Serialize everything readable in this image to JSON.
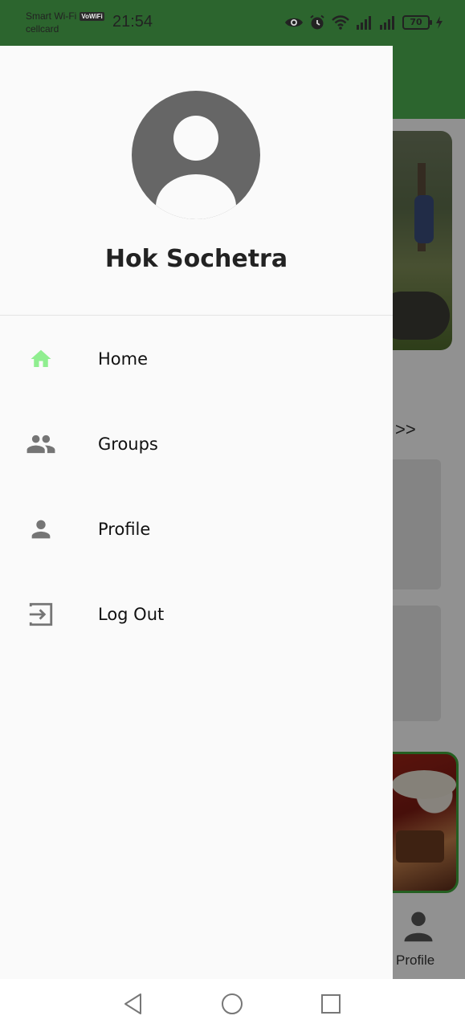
{
  "status_bar": {
    "carrier_top": "Smart Wi-Fi",
    "vowifi_badge": "VoWiFi",
    "carrier_bottom": "cellcard",
    "time": "21:54",
    "battery_level": "70",
    "icons": [
      "eye-icon",
      "alarm-icon",
      "wifi-icon",
      "signal-icon",
      "signal-icon",
      "battery-icon",
      "charging-icon"
    ]
  },
  "drawer": {
    "user_name": "Hok Sochetra",
    "items": [
      {
        "label": "Home",
        "icon": "home-icon",
        "active": true
      },
      {
        "label": "Groups",
        "icon": "groups-icon",
        "active": false
      },
      {
        "label": "Profile",
        "icon": "person-icon",
        "active": false
      },
      {
        "label": "Log Out",
        "icon": "logout-icon",
        "active": false
      }
    ]
  },
  "background": {
    "view_all": "w >>",
    "nav_profile_label": "Profile"
  },
  "colors": {
    "app_bar": "#4caf50",
    "active_icon": "#90ee90",
    "inactive_icon": "#757575",
    "avatar": "#666666"
  }
}
